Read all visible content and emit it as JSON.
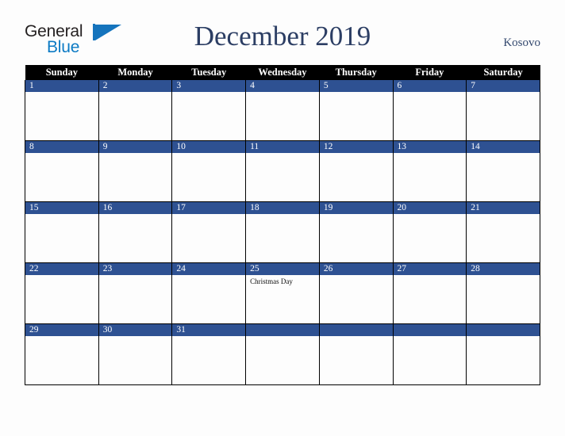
{
  "brand": {
    "name_part1": "General",
    "name_part2": "Blue",
    "triangle_color": "#1574bd",
    "blue_color": "#0b7ac4",
    "dark_color": "#231f20"
  },
  "header": {
    "title": "December 2019",
    "country": "Kosovo",
    "title_color": "#2c3e64",
    "country_color": "#34496f"
  },
  "calendar": {
    "weekday_headers": [
      "Sunday",
      "Monday",
      "Tuesday",
      "Wednesday",
      "Thursday",
      "Friday",
      "Saturday"
    ],
    "header_bg": "#000000",
    "header_text_color": "#ffffff",
    "daybar_bg": "#2e5192",
    "daybar_text_color": "#ffffff",
    "cell_bg": "#fdfdfd",
    "grid_line_color": "#000000",
    "month": "December",
    "year": "2019",
    "weeks": [
      [
        {
          "day": "1",
          "event": ""
        },
        {
          "day": "2",
          "event": ""
        },
        {
          "day": "3",
          "event": ""
        },
        {
          "day": "4",
          "event": ""
        },
        {
          "day": "5",
          "event": ""
        },
        {
          "day": "6",
          "event": ""
        },
        {
          "day": "7",
          "event": ""
        }
      ],
      [
        {
          "day": "8",
          "event": ""
        },
        {
          "day": "9",
          "event": ""
        },
        {
          "day": "10",
          "event": ""
        },
        {
          "day": "11",
          "event": ""
        },
        {
          "day": "12",
          "event": ""
        },
        {
          "day": "13",
          "event": ""
        },
        {
          "day": "14",
          "event": ""
        }
      ],
      [
        {
          "day": "15",
          "event": ""
        },
        {
          "day": "16",
          "event": ""
        },
        {
          "day": "17",
          "event": ""
        },
        {
          "day": "18",
          "event": ""
        },
        {
          "day": "19",
          "event": ""
        },
        {
          "day": "20",
          "event": ""
        },
        {
          "day": "21",
          "event": ""
        }
      ],
      [
        {
          "day": "22",
          "event": ""
        },
        {
          "day": "23",
          "event": ""
        },
        {
          "day": "24",
          "event": ""
        },
        {
          "day": "25",
          "event": "Christmas Day"
        },
        {
          "day": "26",
          "event": ""
        },
        {
          "day": "27",
          "event": ""
        },
        {
          "day": "28",
          "event": ""
        }
      ],
      [
        {
          "day": "29",
          "event": ""
        },
        {
          "day": "30",
          "event": ""
        },
        {
          "day": "31",
          "event": ""
        },
        {
          "day": "",
          "event": ""
        },
        {
          "day": "",
          "event": ""
        },
        {
          "day": "",
          "event": ""
        },
        {
          "day": "",
          "event": ""
        }
      ]
    ]
  }
}
